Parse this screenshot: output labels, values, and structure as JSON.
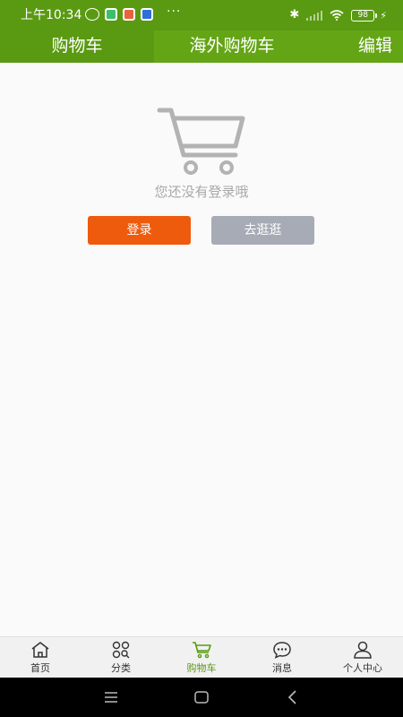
{
  "status_bar": {
    "time": "上午10:34",
    "more": "···",
    "battery": "98",
    "bluetooth_icon": "bluetooth-icon",
    "wifi_icon": "wifi-icon"
  },
  "header": {
    "tabs": [
      {
        "label": "购物车",
        "active": true
      },
      {
        "label": "海外购物车",
        "active": false
      }
    ],
    "edit_label": "编辑"
  },
  "empty_state": {
    "icon": "cart-icon",
    "message": "您还没有登录哦",
    "login_label": "登录",
    "browse_label": "去逛逛"
  },
  "bottom_nav": {
    "items": [
      {
        "label": "首页",
        "icon": "home-icon"
      },
      {
        "label": "分类",
        "icon": "category-icon"
      },
      {
        "label": "购物车",
        "icon": "cart-icon",
        "active": true
      },
      {
        "label": "消息",
        "icon": "message-icon"
      },
      {
        "label": "个人中心",
        "icon": "user-icon"
      }
    ]
  },
  "colors": {
    "brand_green": "#64a516",
    "login_orange": "#ee5b0c",
    "browse_gray": "#a7abb6"
  }
}
